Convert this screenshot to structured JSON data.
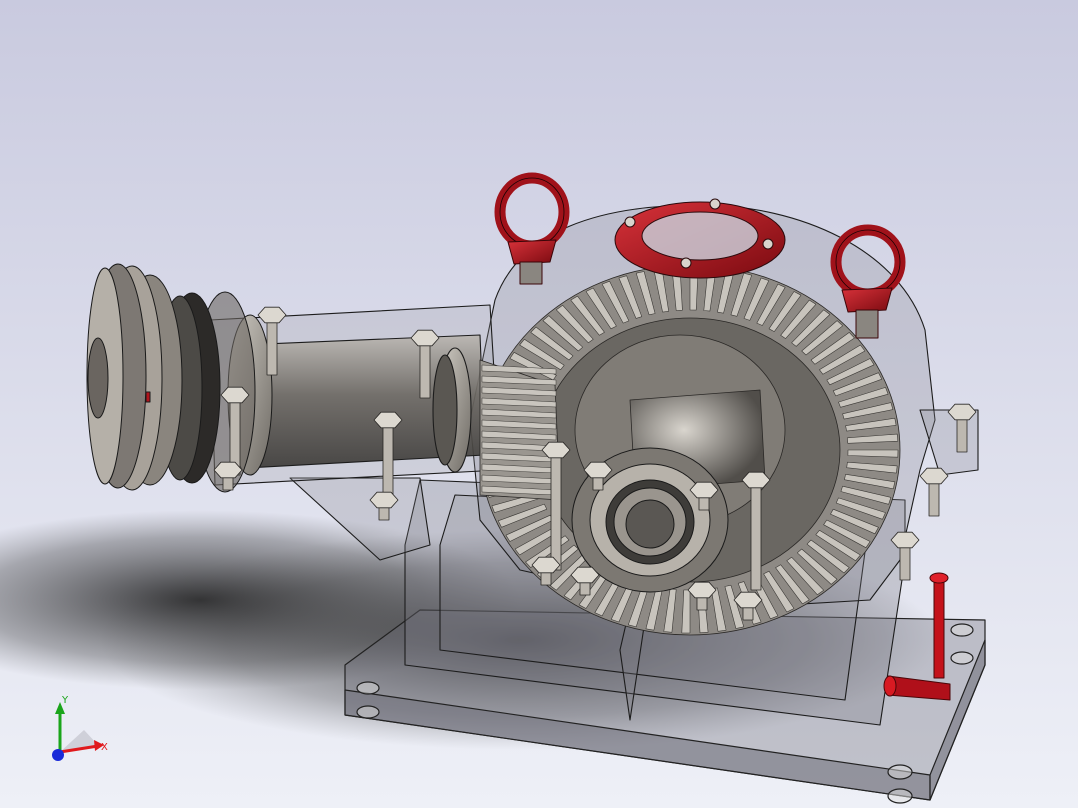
{
  "viewport": {
    "background_top": "#c9cadf",
    "background_bottom": "#eef0f7",
    "model_description_colors": {
      "housing_edge": "#222222",
      "housing_fill": "#8a8a92",
      "gear_metal": "#9a9692",
      "gear_dark": "#4a4845",
      "lifting_eye": "#b0141c",
      "bolt": "#d8d4cc",
      "pulley": "#7d7873",
      "oil_gauge": "#c4121a"
    }
  },
  "triad": {
    "x_label": "X",
    "y_label": "Y",
    "x_color": "#e0191c",
    "y_color": "#1aa51a",
    "z_color": "#1a2ad8"
  }
}
